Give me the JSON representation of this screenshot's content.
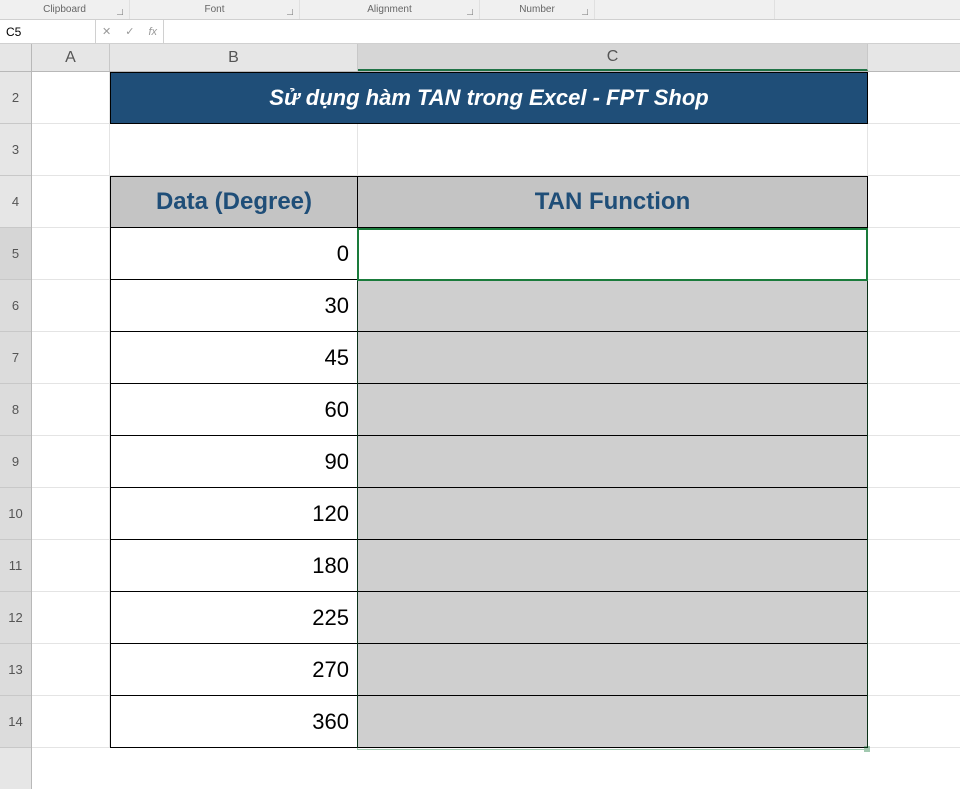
{
  "ribbon": {
    "groups": [
      "Clipboard",
      "Font",
      "Alignment",
      "Number",
      ""
    ]
  },
  "nameBox": "C5",
  "formulaBar": "",
  "columns": [
    "A",
    "B",
    "C"
  ],
  "rowNumbers": [
    2,
    3,
    4,
    5,
    6,
    7,
    8,
    9,
    10,
    11,
    12,
    13,
    14
  ],
  "title": "Sử dụng hàm TAN trong Excel - FPT Shop",
  "tableHeaders": {
    "b": "Data (Degree)",
    "c": "TAN Function"
  },
  "dataRows": [
    {
      "row": 5,
      "degree": 0,
      "tan": ""
    },
    {
      "row": 6,
      "degree": 30,
      "tan": ""
    },
    {
      "row": 7,
      "degree": 45,
      "tan": ""
    },
    {
      "row": 8,
      "degree": 60,
      "tan": ""
    },
    {
      "row": 9,
      "degree": 90,
      "tan": ""
    },
    {
      "row": 10,
      "degree": 120,
      "tan": ""
    },
    {
      "row": 11,
      "degree": 180,
      "tan": ""
    },
    {
      "row": 12,
      "degree": 225,
      "tan": ""
    },
    {
      "row": 13,
      "degree": 270,
      "tan": ""
    },
    {
      "row": 14,
      "degree": 360,
      "tan": ""
    }
  ],
  "activeCell": "C5"
}
